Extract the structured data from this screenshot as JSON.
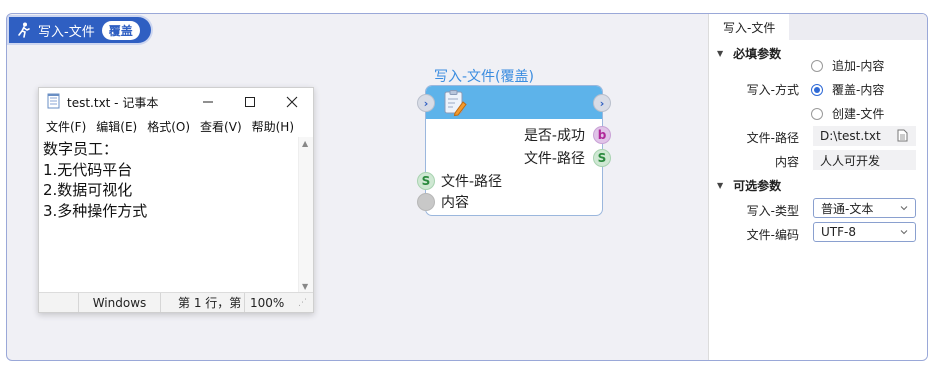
{
  "header": {
    "title": "写入-文件",
    "badge": "覆盖"
  },
  "notepad": {
    "title": "test.txt - 记事本",
    "menu": [
      "文件(F)",
      "编辑(E)",
      "格式(O)",
      "查看(V)",
      "帮助(H)"
    ],
    "content": "数字员工：\n1.无代码平台\n2.数据可视化\n3.多种操作方式",
    "status": {
      "encoding": "Windows",
      "position": "第 1 行，第",
      "zoom": "100%"
    }
  },
  "node": {
    "title": "写入-文件(覆盖)",
    "outputs": [
      {
        "label": "是否-成功",
        "type": "b"
      },
      {
        "label": "文件-路径",
        "type": "S"
      }
    ],
    "inputs": [
      {
        "label": "文件-路径",
        "type": "S"
      },
      {
        "label": "内容",
        "type": ""
      }
    ]
  },
  "panel": {
    "tab": "写入-文件",
    "required_section": "必填参数",
    "optional_section": "可选参数",
    "write_mode": {
      "label": "写入-方式",
      "options": [
        "追加-内容",
        "覆盖-内容",
        "创建-文件"
      ],
      "selected": "覆盖-内容"
    },
    "file_path": {
      "label": "文件-路径",
      "value": "D:\\test.txt"
    },
    "content": {
      "label": "内容",
      "value": "人人可开发"
    },
    "write_type": {
      "label": "写入-类型",
      "value": "普通-文本"
    },
    "file_encoding": {
      "label": "文件-编码",
      "value": "UTF-8"
    }
  },
  "colors": {
    "accent": "#2f5fc2",
    "node_header": "#5db3ea",
    "node_title": "#3b8de0"
  }
}
